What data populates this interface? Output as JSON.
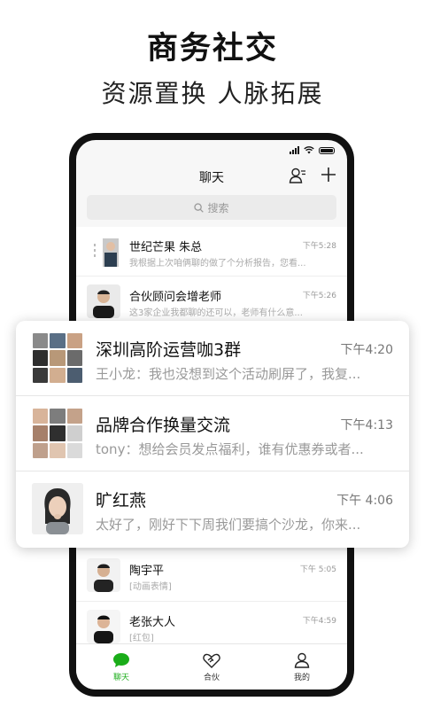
{
  "headline": "商务社交",
  "subline": "资源置换 人脉拓展",
  "phone": {
    "nav_title": "聊天",
    "search_placeholder": "搜索",
    "chats_top": [
      {
        "name": "世纪芒果 朱总",
        "time": "下午5:28",
        "message": "我根据上次咱俩聊的做了个分析报告，您看..."
      },
      {
        "name": "合伙顾问会增老师",
        "time": "下午5:26",
        "message": "这3家企业我都聊的还可以，老师有什么意..."
      }
    ],
    "chats_bottom": [
      {
        "name": "陶宇平",
        "time": "下午 5:05",
        "message": "[动画表情]"
      },
      {
        "name": "老张大人",
        "time": "下午4:59",
        "message": "[红包]"
      }
    ],
    "tabs": [
      {
        "label": "聊天",
        "icon": "chat-bubble-icon",
        "active": true
      },
      {
        "label": "合伙",
        "icon": "handshake-icon",
        "active": false
      },
      {
        "label": "我的",
        "icon": "person-icon",
        "active": false
      }
    ]
  },
  "featured_chats": [
    {
      "name": "深圳高阶运营咖3群",
      "time": "下午4:20",
      "message": "王小龙：我也没想到这个活动刷屏了，我复..."
    },
    {
      "name": "品牌合作换量交流",
      "time": "下午4:13",
      "message": "tony：想给会员发点福利，谁有优惠券或者..."
    },
    {
      "name": "旷红燕",
      "time": "下午 4:06",
      "message": "太好了，刚好下下周我们要搞个沙龙，你来..."
    }
  ],
  "colors": {
    "accent": "#1aad19",
    "text": "#111111",
    "muted": "#999999"
  }
}
